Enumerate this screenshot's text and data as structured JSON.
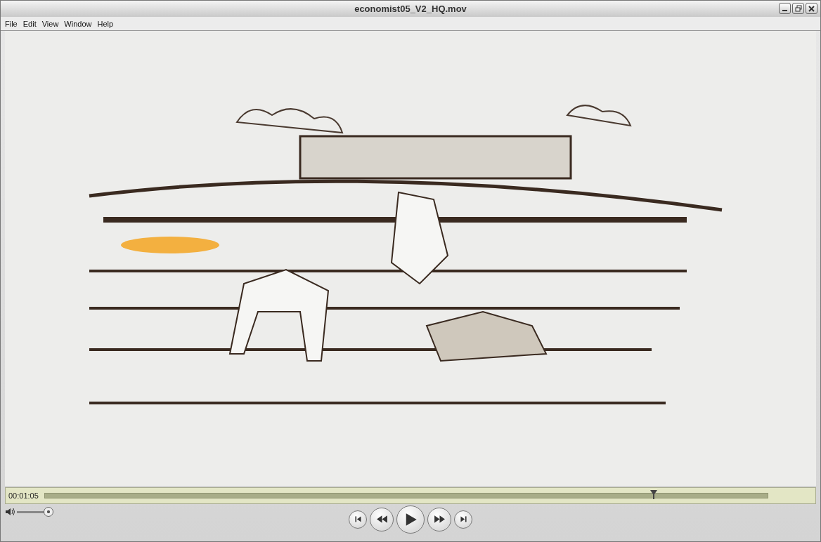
{
  "window": {
    "title": "economist05_V2_HQ.mov"
  },
  "menu": [
    "File",
    "Edit",
    "View",
    "Window",
    "Help"
  ],
  "timeline": {
    "time": "00:01:05",
    "level": 0.843
  },
  "volume": {
    "level": 1.0
  },
  "transport": [
    {
      "kind": "start"
    },
    {
      "kind": "rewind"
    },
    {
      "kind": "play"
    },
    {
      "kind": "forward"
    },
    {
      "kind": "end"
    }
  ]
}
